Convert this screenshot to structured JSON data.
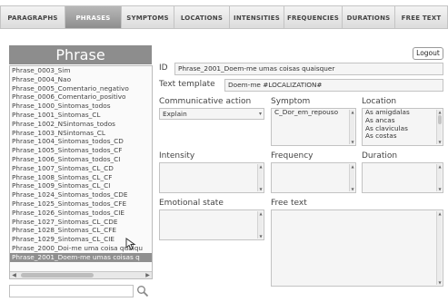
{
  "tabs": [
    {
      "label": "PARAGRAPHS",
      "active": false
    },
    {
      "label": "PHRASES",
      "active": true
    },
    {
      "label": "SYMPTOMS",
      "active": false
    },
    {
      "label": "LOCATIONS",
      "active": false
    },
    {
      "label": "INTENSITIES",
      "active": false
    },
    {
      "label": "FREQUENCIES",
      "active": false
    },
    {
      "label": "DURATIONS",
      "active": false
    },
    {
      "label": "FREE TEXT",
      "active": false
    }
  ],
  "section_title": "Phrase",
  "phrases": [
    "Phrase_0003_Sim",
    "Phrase_0004_Nao",
    "Phrase_0005_Comentario_negativo",
    "Phrase_0006_Comentario_positivo",
    "Phrase_1000_Sintomas_todos",
    "Phrase_1001_Sintomas_CL",
    "Phrase_1002_NSintomas_todos",
    "Phrase_1003_NSintomas_CL",
    "Phrase_1004_Sintomas_todos_CD",
    "Phrase_1005_Sintomas_todos_CF",
    "Phrase_1006_Sintomas_todos_CI",
    "Phrase_1007_Sintomas_CL_CD",
    "Phrase_1008_Sintomas_CL_CF",
    "Phrase_1009_Sintomas_CL_CI",
    "Phrase_1024_Sintomas_todos_CDE",
    "Phrase_1025_Sintomas_todos_CFE",
    "Phrase_1026_Sintomas_todos_CIE",
    "Phrase_1027_Sintomas_CL_CDE",
    "Phrase_1028_Sintomas_CL_CFE",
    "Phrase_1029_Sintomas_CL_CIE",
    "Phrase_2000_Doi-me uma coisa qualqu",
    "Phrase_2001_Doem-me umas coisas q"
  ],
  "selected_phrase_index": 21,
  "search": {
    "value": "",
    "placeholder": ""
  },
  "logout_label": "Logout",
  "form": {
    "id_label": "ID",
    "id_value": "Phrase_2001_Doem-me umas coisas quaisquer",
    "template_label": "Text template",
    "template_value": "Doem-me #LOCALIZATION#",
    "communicative_action_label": "Communicative action",
    "communicative_action_value": "Explain",
    "symptom_label": "Symptom",
    "symptom_options": [
      "C_Dor_em_repouso"
    ],
    "location_label": "Location",
    "location_options": [
      "As amigdalas",
      "As ancas",
      "As claviculas",
      "As costas"
    ],
    "intensity_label": "Intensity",
    "frequency_label": "Frequency",
    "duration_label": "Duration",
    "emotional_state_label": "Emotional state",
    "free_text_label": "Free text"
  },
  "colors": {
    "active_tab": "#9a9a9a",
    "title_bg": "#8d8d8d",
    "selected_row": "#8f8f8f"
  }
}
